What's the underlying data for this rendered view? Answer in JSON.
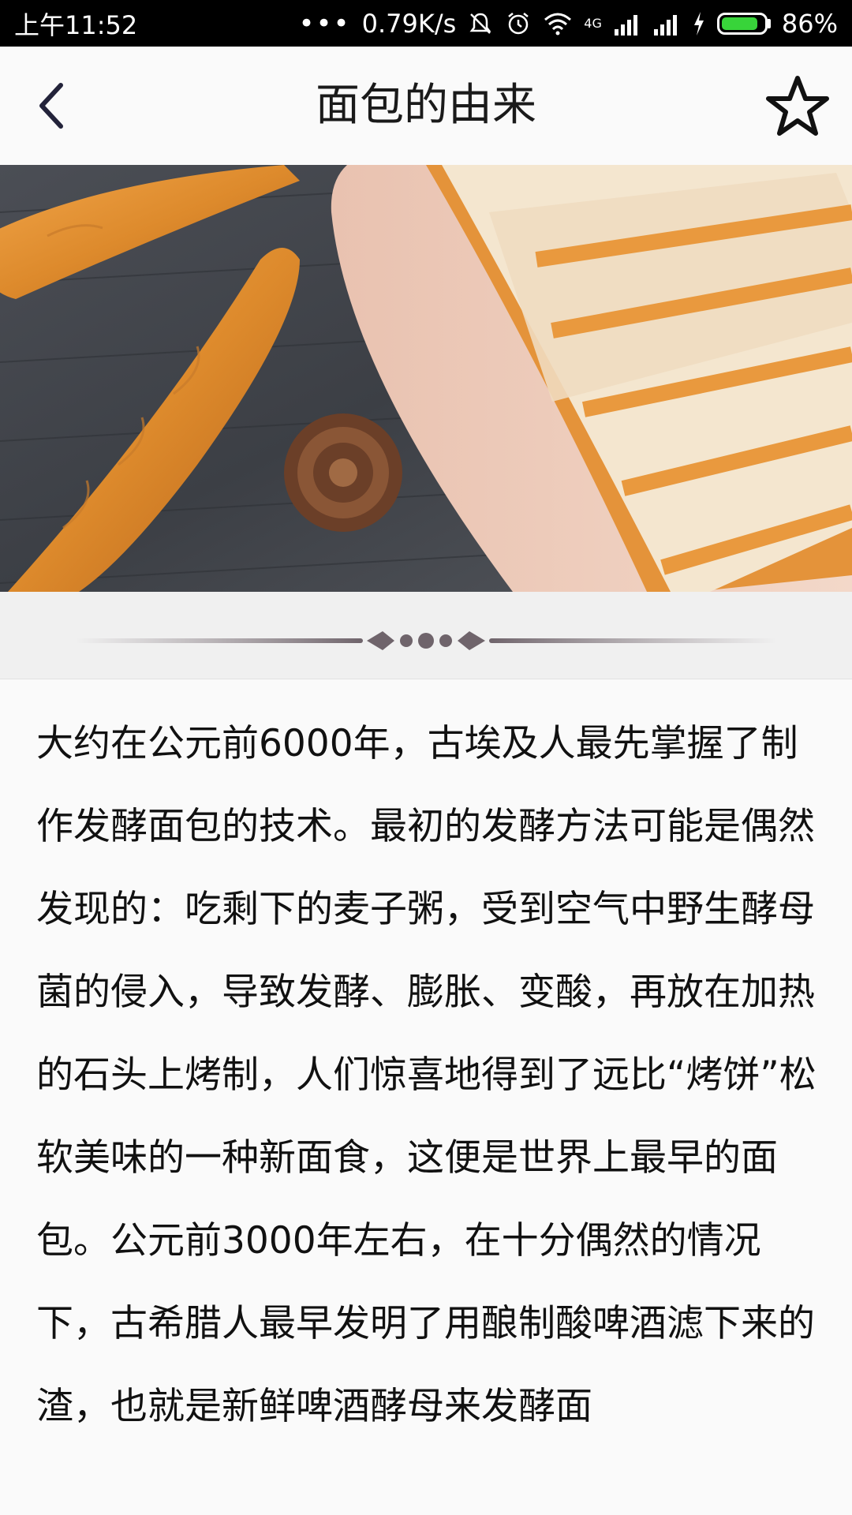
{
  "status_bar": {
    "time": "上午11:52",
    "dots": "•••",
    "network_speed": "0.79K/s",
    "network_type": "4G",
    "battery_percent_text": "86%",
    "battery_level": 0.86,
    "battery_color": "#38d43a",
    "icons": [
      "mute-icon",
      "alarm-icon",
      "wifi-icon",
      "signal-icon",
      "signal-icon",
      "charging-icon",
      "battery-icon"
    ]
  },
  "app_bar": {
    "title": "面包的由来",
    "back_icon": "chevron-left-icon",
    "favorite_icon": "star-outline-icon"
  },
  "hero": {
    "icon": "bread-photo"
  },
  "article": {
    "paragraphs": [
      "大约在公元前6000年，古埃及人最先掌握了制作发酵面包的技术。最初的发酵方法可能是偶然发现的：吃剩下的麦子粥，受到空气中野生酵母菌的侵入，导致发酵、膨胀、变酸，再放在加热的石头上烤制，人们惊喜地得到了远比“烤饼”松软美味的一种新面食，这便是世界上最早的面包。公元前3000年左右，在十分偶然的情况下，古希腊人最早发明了用酿制酸啤酒滤下来的渣，也就是新鲜啤酒酵母来发酵面"
    ]
  }
}
